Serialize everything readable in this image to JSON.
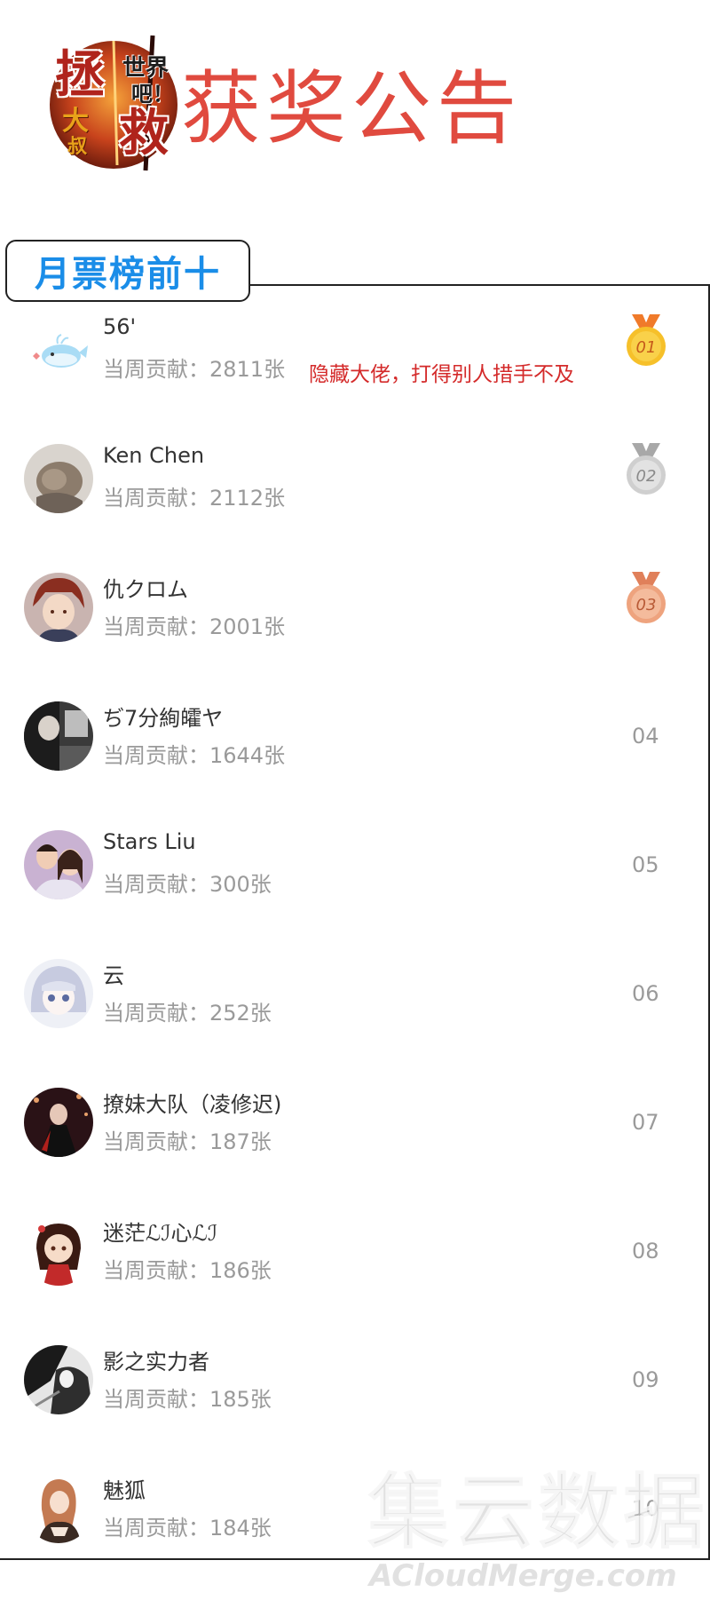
{
  "header": {
    "logo_text": [
      "拯",
      "救",
      "世界",
      "吧！",
      "大",
      "叔"
    ],
    "title": "获奖公告"
  },
  "tab": {
    "label": "月票榜前十"
  },
  "colors": {
    "title_red": "#e04a3f",
    "tab_blue": "#1a8de8",
    "note_red": "#d42a2a",
    "gold": "#f2b21b",
    "silver": "#c9c9c9",
    "bronze": "#eaa07a",
    "gray_text": "#9a9a9a"
  },
  "rows": [
    {
      "name": "56'",
      "contribution": "当周贡献：2811张",
      "rank": "01",
      "medal": "gold",
      "note": "隐藏大佬，打得别人措手不及",
      "avatar": "whale-avatar"
    },
    {
      "name": "Ken Chen",
      "contribution": "当周贡献：2112张",
      "rank": "02",
      "medal": "silver",
      "avatar": "animal-avatar"
    },
    {
      "name": "仇クロム",
      "contribution": "当周贡献：2001张",
      "rank": "03",
      "medal": "bronze",
      "avatar": "anime-boy-avatar"
    },
    {
      "name": " ぢ7分絢皬ヤ",
      "contribution": "当周贡献：1644张",
      "rank": "04",
      "avatar": "photo-avatar"
    },
    {
      "name": "Stars Liu",
      "contribution": "当周贡献：300张",
      "rank": "05",
      "avatar": "couple-avatar"
    },
    {
      "name": "云",
      "contribution": "当周贡献：252张",
      "rank": "06",
      "avatar": "anime-girl-avatar"
    },
    {
      "name": "撩妹大队（凌修迟)",
      "contribution": "当周贡献：187张",
      "rank": "07",
      "avatar": "dark-figure-avatar"
    },
    {
      "name": "迷茫ℒℐ心ℒℐ",
      "contribution": "当周贡献：186张",
      "rank": "08",
      "avatar": "chibi-avatar"
    },
    {
      "name": "影之实力者",
      "contribution": "当周贡献：185张",
      "rank": "09",
      "avatar": "shadow-avatar"
    },
    {
      "name": "魅狐",
      "contribution": "当周贡献：184张",
      "rank": "10",
      "avatar": "fox-girl-avatar"
    }
  ],
  "watermark": {
    "cn": "集云数据",
    "en": "ACloudMerge.com"
  }
}
